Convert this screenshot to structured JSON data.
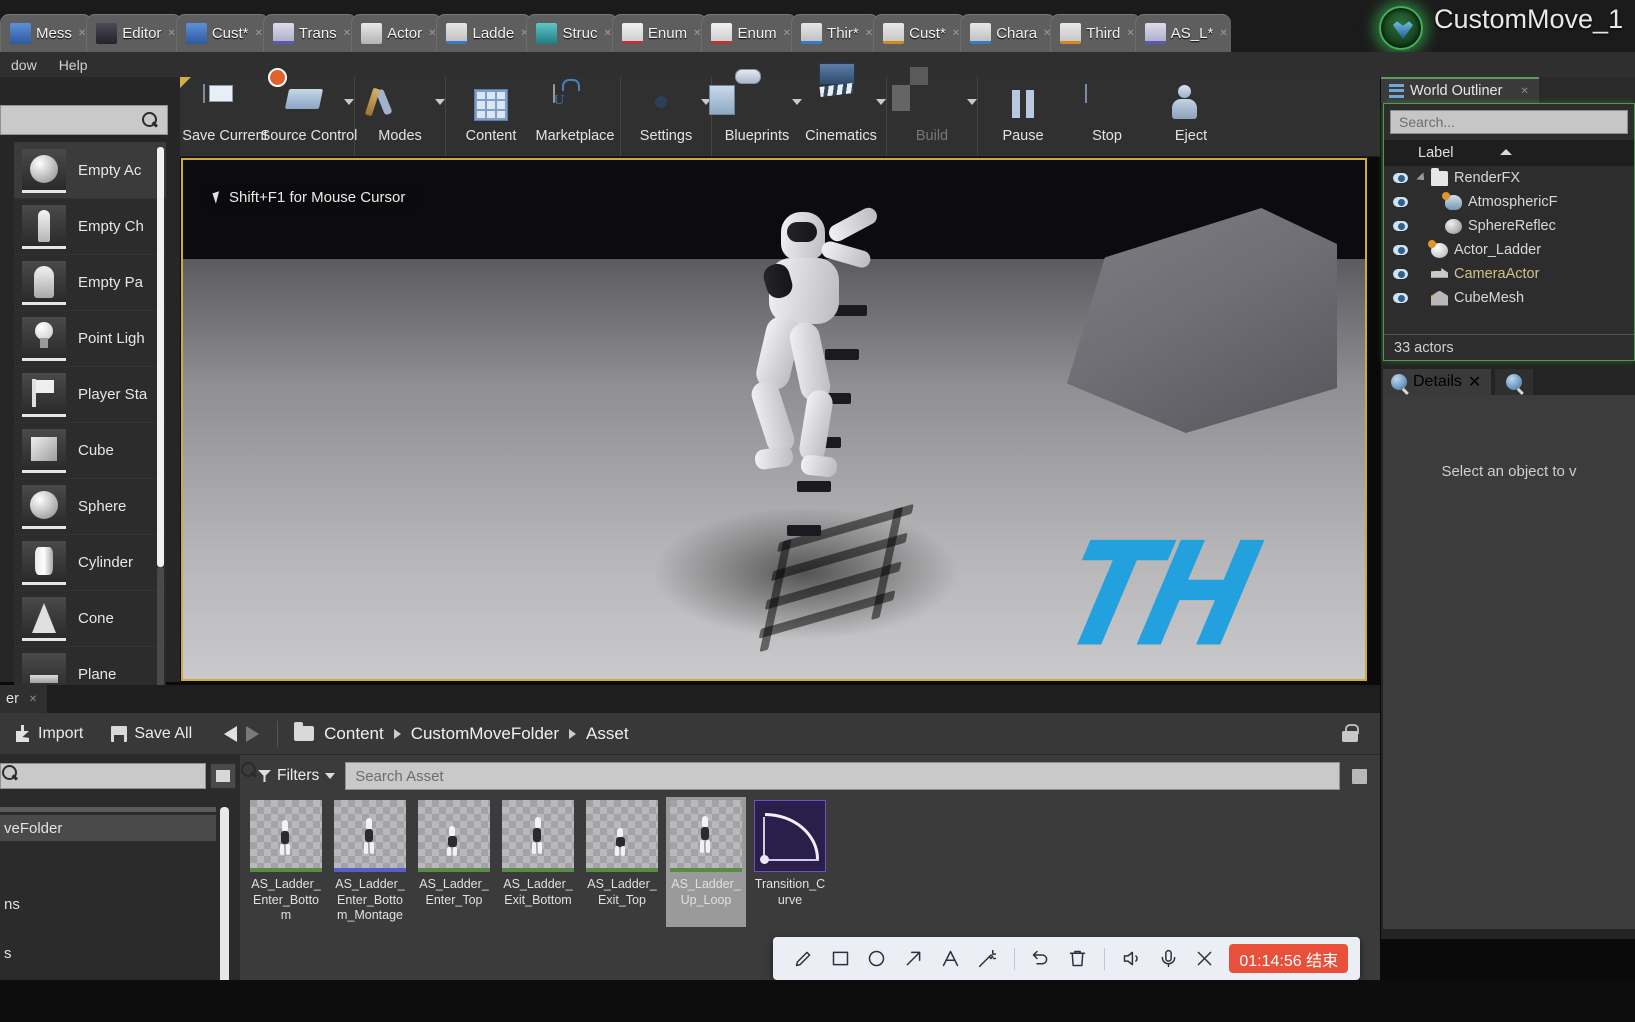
{
  "window": {
    "app_title": "CustomMove_1",
    "app_badge_icon": "unreal-engine-logo-icon"
  },
  "tabs": [
    {
      "label": "Mess",
      "icon": "message-log-icon",
      "style": "blue"
    },
    {
      "label": "Editor",
      "icon": "editor-utility-icon",
      "style": "dk"
    },
    {
      "label": "Cust*",
      "icon": "custom-blueprint-icon",
      "style": "blue"
    },
    {
      "label": "Trans",
      "icon": "transition-curve-icon",
      "style": "purple"
    },
    {
      "label": "Actor",
      "icon": "actor-icon",
      "style": "white"
    },
    {
      "label": "Ladde",
      "icon": "animation-icon",
      "style": "bluebar"
    },
    {
      "label": "Struc",
      "icon": "structure-icon",
      "style": "teal"
    },
    {
      "label": "Enum",
      "icon": "enum-icon",
      "style": "red"
    },
    {
      "label": "Enum",
      "icon": "enum-icon",
      "style": "red"
    },
    {
      "label": "Thir*",
      "icon": "third-person-icon",
      "style": "bluebar"
    },
    {
      "label": "Cust*",
      "icon": "custom-anim-icon",
      "style": "orange"
    },
    {
      "label": "Chara",
      "icon": "character-icon",
      "style": "bluebar"
    },
    {
      "label": "Third",
      "icon": "third-icon",
      "style": "orange"
    },
    {
      "label": "AS_L*",
      "icon": "anim-sequence-icon",
      "style": "purple"
    }
  ],
  "menubar": {
    "items": [
      {
        "label": "dow"
      },
      {
        "label": "Help"
      }
    ]
  },
  "toolbar": {
    "groups": [
      {
        "buttons": [
          {
            "label": "Save Current",
            "icon": "save-icon",
            "has_caret": false,
            "disabled": false
          },
          {
            "label": "Source Control",
            "icon": "source-control-icon",
            "has_caret": true,
            "disabled": false
          }
        ]
      },
      {
        "buttons": [
          {
            "label": "Modes",
            "icon": "modes-icon",
            "has_caret": true,
            "disabled": false
          }
        ]
      },
      {
        "buttons": [
          {
            "label": "Content",
            "icon": "content-browser-icon",
            "has_caret": false,
            "disabled": false
          },
          {
            "label": "Marketplace",
            "icon": "marketplace-icon",
            "has_caret": false,
            "disabled": false
          }
        ]
      },
      {
        "buttons": [
          {
            "label": "Settings",
            "icon": "gear-icon",
            "has_caret": true,
            "disabled": false
          }
        ]
      },
      {
        "buttons": [
          {
            "label": "Blueprints",
            "icon": "blueprints-icon",
            "has_caret": true,
            "disabled": false
          },
          {
            "label": "Cinematics",
            "icon": "cinematics-icon",
            "has_caret": true,
            "disabled": false
          }
        ]
      },
      {
        "buttons": [
          {
            "label": "Build",
            "icon": "build-icon",
            "has_caret": true,
            "disabled": true
          }
        ]
      },
      {
        "buttons": [
          {
            "label": "Pause",
            "icon": "pause-icon",
            "has_caret": false,
            "disabled": false
          },
          {
            "label": "Stop",
            "icon": "stop-icon",
            "has_caret": false,
            "disabled": false
          },
          {
            "label": "Eject",
            "icon": "eject-icon",
            "has_caret": false,
            "disabled": false
          }
        ]
      }
    ]
  },
  "place_panel": {
    "search_placeholder": "",
    "items": [
      {
        "label": "Empty Ac",
        "icon": "empty-actor-icon",
        "shape": "sphere",
        "selected": true
      },
      {
        "label": "Empty Ch",
        "icon": "empty-character-icon",
        "shape": "char",
        "selected": false
      },
      {
        "label": "Empty Pa",
        "icon": "empty-pawn-icon",
        "shape": "pawn",
        "selected": false
      },
      {
        "label": "Point Ligh",
        "icon": "point-light-icon",
        "shape": "bulb",
        "selected": false
      },
      {
        "label": "Player Sta",
        "icon": "player-start-icon",
        "shape": "flag",
        "selected": false
      },
      {
        "label": "Cube",
        "icon": "cube-icon",
        "shape": "cube",
        "selected": false
      },
      {
        "label": "Sphere",
        "icon": "sphere-icon",
        "shape": "sphere",
        "selected": false
      },
      {
        "label": "Cylinder",
        "icon": "cylinder-icon",
        "shape": "cyl",
        "selected": false
      },
      {
        "label": "Cone",
        "icon": "cone-icon",
        "shape": "cone",
        "selected": false
      },
      {
        "label": "Plane",
        "icon": "plane-icon",
        "shape": "plane",
        "selected": false
      }
    ]
  },
  "viewport": {
    "hint": "Shift+F1 for Mouse Cursor",
    "hint_icon": "mouse-cursor-icon",
    "watermark": "TH",
    "watermark_color": "#1ba0e0",
    "border_color": "#d3a93f"
  },
  "outliner": {
    "tab_label": "World Outliner",
    "tab_icon": "world-outliner-icon",
    "search_placeholder": "Search...",
    "column_header": "Label",
    "rows": [
      {
        "label": "RenderFX",
        "indent": 0,
        "icon": "folder-icon",
        "expandable": true,
        "color": "default"
      },
      {
        "label": "AtmosphericF",
        "indent": 1,
        "icon": "atmospheric-fog-icon",
        "expandable": false,
        "color": "default"
      },
      {
        "label": "SphereReflec",
        "indent": 1,
        "icon": "sphere-reflection-icon",
        "expandable": false,
        "color": "default"
      },
      {
        "label": "Actor_Ladder",
        "indent": 0,
        "icon": "actor-icon",
        "expandable": false,
        "color": "default"
      },
      {
        "label": "CameraActor",
        "indent": 0,
        "icon": "camera-icon",
        "expandable": false,
        "color": "camera"
      },
      {
        "label": "CubeMesh",
        "indent": 0,
        "icon": "static-mesh-icon",
        "expandable": false,
        "color": "default"
      }
    ],
    "actor_count": "33 actors"
  },
  "details": {
    "tab_label": "Details",
    "tab_icon": "details-icon",
    "secondary_tab_icon": "world-settings-icon",
    "empty_message": "Select an object to v"
  },
  "content_browser": {
    "tab_label": "er",
    "import_label": "Import",
    "import_icon": "import-icon",
    "save_all_label": "Save All",
    "save_all_icon": "save-all-icon",
    "back_icon": "arrow-left-icon",
    "forward_icon": "arrow-right-icon",
    "folder_icon": "folder-icon",
    "lock_icon": "lock-icon",
    "breadcrumbs": [
      "Content",
      "CustomMoveFolder",
      "Asset"
    ],
    "filters_label": "Filters",
    "filters_icon": "funnel-icon",
    "search_placeholder": "Search Asset",
    "search_icon": "search-icon",
    "save_icon": "save-icon",
    "sources": [
      {
        "label": "veFolder",
        "selected": true
      },
      {
        "label": "ns",
        "selected": false
      },
      {
        "label": "s",
        "selected": false
      }
    ],
    "assets": [
      {
        "label": "AS_Ladder_Enter_Bottom",
        "type": "anim-sequence",
        "selected": false
      },
      {
        "label": "AS_Ladder_Enter_Bottom_Montage",
        "type": "anim-montage",
        "selected": false
      },
      {
        "label": "AS_Ladder_Enter_Top",
        "type": "anim-sequence",
        "selected": false
      },
      {
        "label": "AS_Ladder_Exit_Bottom",
        "type": "anim-sequence",
        "selected": false
      },
      {
        "label": "AS_Ladder_Exit_Top",
        "type": "anim-sequence",
        "selected": false
      },
      {
        "label": "AS_Ladder_Up_Loop",
        "type": "anim-sequence",
        "selected": true
      },
      {
        "label": "Transition_Curve",
        "type": "curve",
        "selected": false
      }
    ]
  },
  "annotation_toolbar": {
    "tools": [
      {
        "icon": "pencil-icon"
      },
      {
        "icon": "square-icon"
      },
      {
        "icon": "circle-icon"
      },
      {
        "icon": "arrow-icon"
      },
      {
        "icon": "text-icon"
      },
      {
        "icon": "magic-wand-icon"
      }
    ],
    "actions": [
      {
        "icon": "undo-icon"
      },
      {
        "icon": "trash-icon"
      }
    ],
    "media": [
      {
        "icon": "speaker-icon"
      },
      {
        "icon": "microphone-icon"
      },
      {
        "icon": "close-icon"
      }
    ],
    "timer_text": "01:14:56 结束",
    "timer_color": "#e8503a"
  }
}
